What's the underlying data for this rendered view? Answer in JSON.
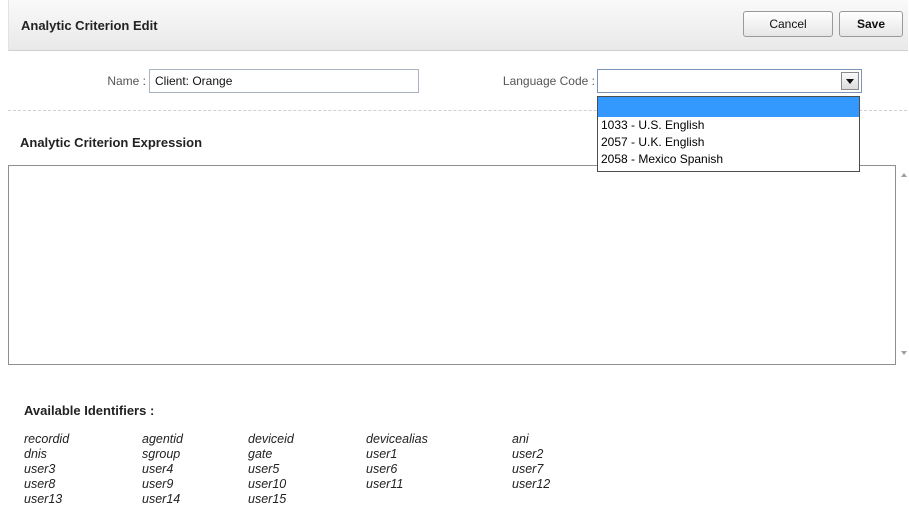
{
  "header": {
    "title": "Analytic Criterion Edit",
    "cancel_label": "Cancel",
    "save_label": "Save"
  },
  "form": {
    "name_label": "Name :",
    "name_value": "Client: Orange",
    "language_label": "Language Code :",
    "language_value": "",
    "language_options": [
      "",
      "1033 - U.S. English",
      "2057 - U.K. English",
      "2058 - Mexico Spanish"
    ]
  },
  "expression": {
    "title": "Analytic Criterion Expression",
    "value": ""
  },
  "identifiers": {
    "title": "Available Identifiers :",
    "items": [
      "recordid",
      "agentid",
      "deviceid",
      "devicealias",
      "ani",
      "dnis",
      "sgroup",
      "gate",
      "user1",
      "user2",
      "user3",
      "user4",
      "user5",
      "user6",
      "user7",
      "user8",
      "user9",
      "user10",
      "user11",
      "user12",
      "user13",
      "user14",
      "user15"
    ]
  },
  "colors": {
    "highlight": "#3399ff",
    "border": "#8f8f8f"
  }
}
